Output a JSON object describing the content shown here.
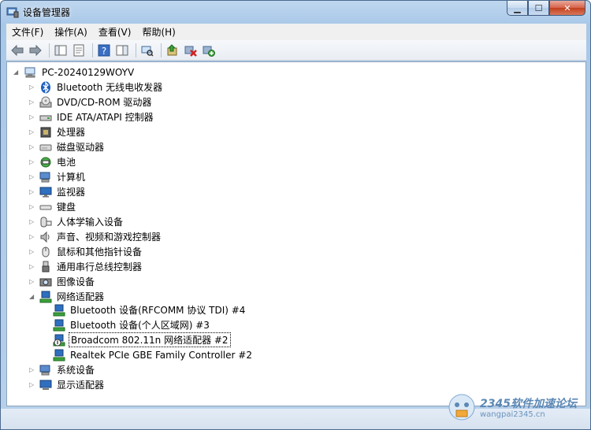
{
  "window": {
    "title": "设备管理器"
  },
  "menu": [
    "文件(F)",
    "操作(A)",
    "查看(V)",
    "帮助(H)"
  ],
  "tree": {
    "root": "PC-20240129WOYV",
    "categories": [
      "Bluetooth 无线电收发器",
      "DVD/CD-ROM 驱动器",
      "IDE ATA/ATAPI 控制器",
      "处理器",
      "磁盘驱动器",
      "电池",
      "计算机",
      "监视器",
      "键盘",
      "人体学输入设备",
      "声音、视频和游戏控制器",
      "鼠标和其他指针设备",
      "通用串行总线控制器",
      "图像设备",
      "网络适配器"
    ],
    "network_children": [
      "Bluetooth 设备(RFCOMM 协议 TDI) #4",
      "Bluetooth 设备(个人区域网) #3",
      "Broadcom 802.11n 网络适配器 #2",
      "Realtek PCIe GBE Family Controller #2"
    ],
    "after": [
      "系统设备",
      "显示适配器"
    ]
  },
  "watermark": {
    "text": "2345软件加速论坛",
    "sub": "wangpai2345.cn"
  },
  "colors": {
    "accent": "#2e6fc0",
    "titlebar": "#bfd7ef"
  }
}
